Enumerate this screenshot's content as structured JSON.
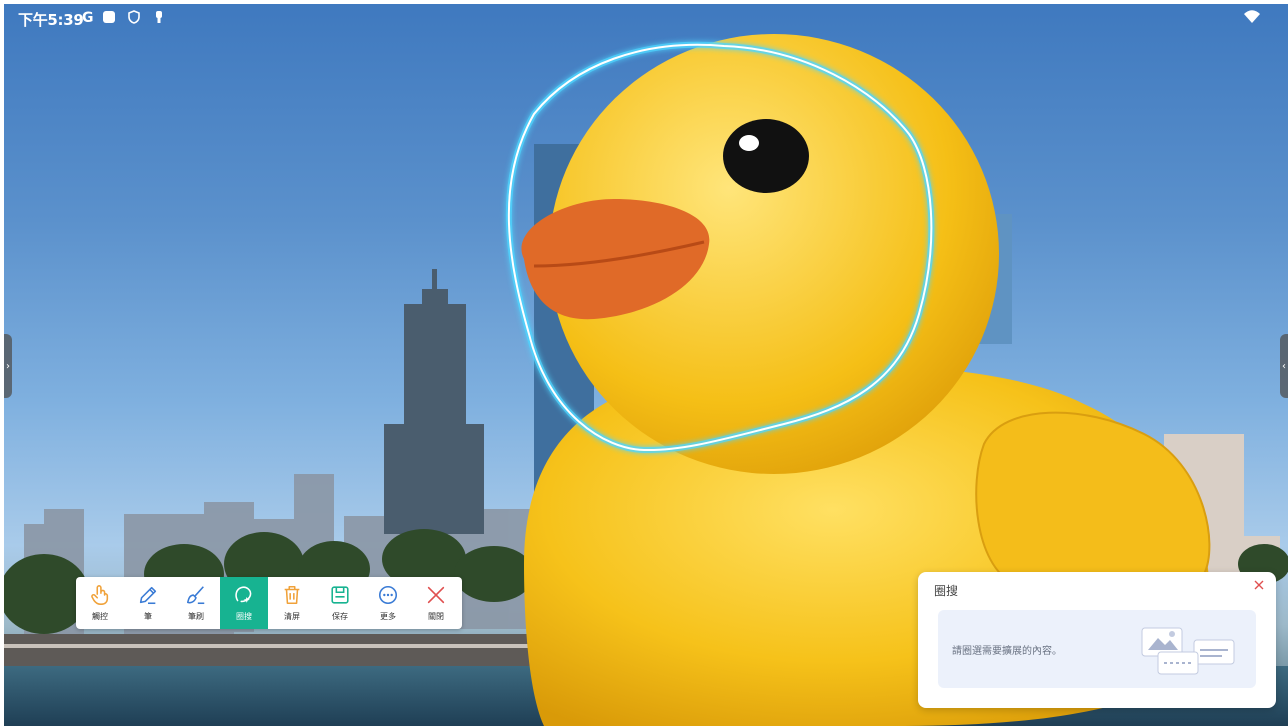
{
  "status_bar": {
    "time": "下午5:39",
    "icons": [
      "google-g-icon",
      "square-app-icon",
      "shield-icon",
      "key-icon"
    ],
    "right_icons": [
      "wifi-icon"
    ]
  },
  "toolbar": {
    "tools": [
      {
        "label": "觸控",
        "icon": "hand-pointer-icon",
        "active": false,
        "color": "#f0a23a"
      },
      {
        "label": "筆",
        "icon": "pen-icon",
        "active": false,
        "color": "#3a7bd5"
      },
      {
        "label": "筆刷",
        "icon": "brush-icon",
        "active": false,
        "color": "#3a7bd5"
      },
      {
        "label": "圈搜",
        "icon": "circle-search-icon",
        "active": true,
        "color": "#17b391"
      },
      {
        "label": "清屏",
        "icon": "trash-icon",
        "active": false,
        "color": "#f0a23a"
      },
      {
        "label": "保存",
        "icon": "save-icon",
        "active": false,
        "color": "#17b391"
      },
      {
        "label": "更多",
        "icon": "more-icon",
        "active": false,
        "color": "#3a7bd5"
      },
      {
        "label": "關閉",
        "icon": "close-icon",
        "active": false,
        "color": "#e05050"
      }
    ]
  },
  "panel": {
    "title": "圈搜",
    "hint": "請圈選需要擴展的內容。",
    "close_icon": "close-icon"
  },
  "colors": {
    "accent": "#17b391",
    "selection_glow": "#4fd6ff",
    "duck_yellow": "#f6c21a"
  }
}
